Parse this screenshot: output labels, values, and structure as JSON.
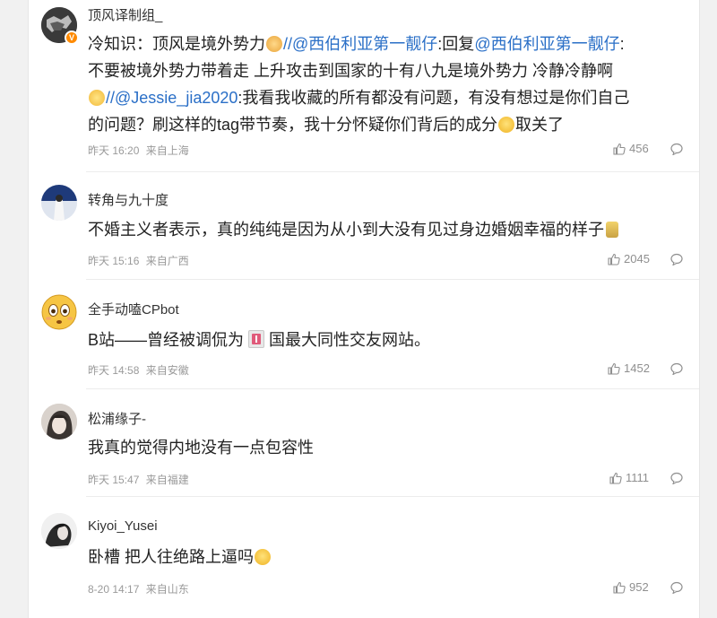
{
  "comments": [
    {
      "user": "顶风译制组_",
      "verified": "V",
      "lines": [
        [
          "冷知识：顶风是境外势力",
          "//",
          "@西伯利亚第一靓仔",
          ":回复",
          "@西伯利亚第一靓仔",
          ":"
        ],
        [
          "不要被境外势力带着走 上升攻击到国家的十有八九是境外势力 冷静冷静啊"
        ],
        [
          "//",
          "@Jessie_jia2020",
          ":我看我收藏的所有都没有问题，有没有想过是你们自己"
        ],
        [
          "的问题？刷这样的tag带节奏，我十分怀疑你们背后的成分",
          "取关了"
        ]
      ],
      "time": "昨天 16:20",
      "location": "来自上海",
      "likes": "456"
    },
    {
      "user": "转角与九十度",
      "text": "不婚主义者表示，真的纯纯是因为从小到大没有见过身边婚姻幸福的样子",
      "time": "昨天 15:16",
      "location": "来自广西",
      "likes": "2045"
    },
    {
      "user": "全手动嗑CPbot",
      "text_a": "B站——曾经被调侃为",
      "text_b": "国最大同性交友网站。",
      "time": "昨天 14:58",
      "location": "来自安徽",
      "likes": "1452"
    },
    {
      "user": "松浦缘子-",
      "text": "我真的觉得内地没有一点包容性",
      "time": "昨天 15:47",
      "location": "来自福建",
      "likes": "1111"
    },
    {
      "user": "Kiyoi_Yusei",
      "text": "卧槽 把人往绝路上逼吗",
      "time": "8-20 14:17",
      "location": "来自山东",
      "likes": "952"
    }
  ],
  "colors": {
    "mention": "#2a6fc7",
    "text": "#222222",
    "meta": "#9a9a9a",
    "badge": "#ff8a00"
  },
  "icons": [
    "thumb-up-icon",
    "comment-icon",
    "emoji-icon",
    "flag-emoji-icon"
  ]
}
